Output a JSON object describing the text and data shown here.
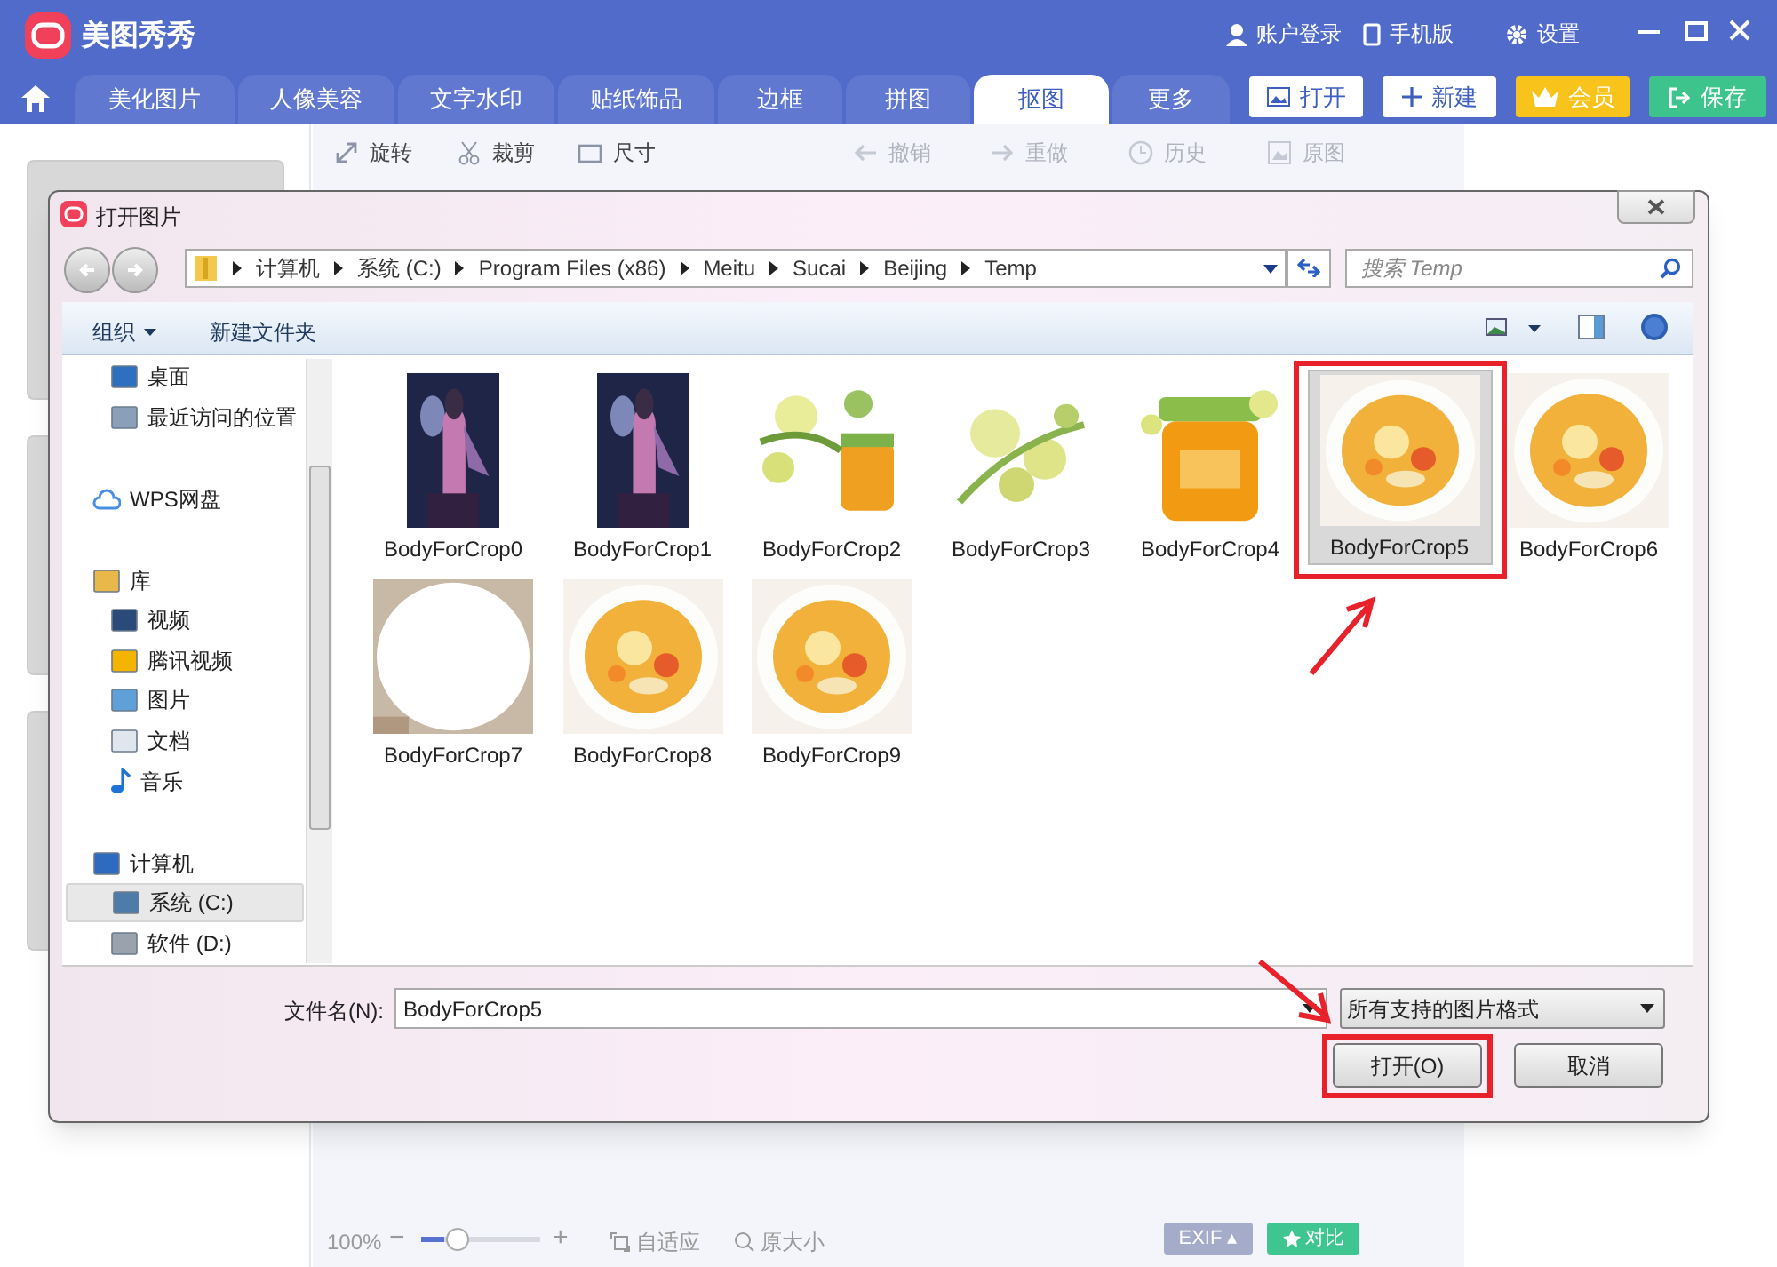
{
  "app": {
    "title": "美图秀秀",
    "top_links": [
      "账户登录",
      "手机版",
      "设置"
    ]
  },
  "tabs": [
    {
      "label": "美化图片",
      "selected": false
    },
    {
      "label": "人像美容",
      "selected": false
    },
    {
      "label": "文字水印",
      "selected": false
    },
    {
      "label": "贴纸饰品",
      "selected": false
    },
    {
      "label": "边框",
      "selected": false
    },
    {
      "label": "拼图",
      "selected": false
    },
    {
      "label": "抠图",
      "selected": true
    },
    {
      "label": "更多",
      "selected": false
    }
  ],
  "actions": [
    {
      "label": "打开",
      "kind": "open"
    },
    {
      "label": "新建",
      "kind": "new"
    },
    {
      "label": "会员",
      "kind": "vip"
    },
    {
      "label": "保存",
      "kind": "save"
    }
  ],
  "toolbar": [
    {
      "label": "旋转",
      "disabled": false
    },
    {
      "label": "裁剪",
      "disabled": false
    },
    {
      "label": "尺寸",
      "disabled": false
    },
    {
      "label": "撤销",
      "disabled": true
    },
    {
      "label": "重做",
      "disabled": true
    },
    {
      "label": "历史",
      "disabled": true
    },
    {
      "label": "原图",
      "disabled": true
    }
  ],
  "dialog": {
    "title": "打开图片",
    "path": [
      "计算机",
      "系统 (C:)",
      "Program Files (x86)",
      "Meitu",
      "Sucai",
      "Beijing",
      "Temp"
    ],
    "search": {
      "placeholder": "搜索 Temp"
    },
    "commands": [
      "组织",
      "新建文件夹"
    ],
    "nav": [
      {
        "children": [
          {
            "label": "桌面",
            "selected": false
          },
          {
            "label": "最近访问的位置",
            "selected": false
          }
        ]
      },
      {
        "label": "WPS网盘"
      },
      {
        "label": "库",
        "children": [
          {
            "label": "视频",
            "selected": false
          },
          {
            "label": "腾讯视频",
            "selected": false
          },
          {
            "label": "图片",
            "selected": false
          },
          {
            "label": "文档",
            "selected": false
          },
          {
            "label": "音乐",
            "selected": false
          }
        ]
      },
      {
        "label": "计算机",
        "children": [
          {
            "label": "系统 (C:)",
            "selected": true
          },
          {
            "label": "软件 (D:)",
            "selected": false
          }
        ]
      }
    ],
    "files": [
      {
        "name": "BodyForCrop0",
        "selected": false,
        "highlighted": false
      },
      {
        "name": "BodyForCrop1",
        "selected": false,
        "highlighted": false
      },
      {
        "name": "BodyForCrop2",
        "selected": false,
        "highlighted": false
      },
      {
        "name": "BodyForCrop3",
        "selected": false,
        "highlighted": false
      },
      {
        "name": "BodyForCrop4",
        "selected": false,
        "highlighted": false
      },
      {
        "name": "BodyForCrop5",
        "selected": true,
        "highlighted": true
      },
      {
        "name": "BodyForCrop6",
        "selected": false,
        "highlighted": false
      },
      {
        "name": "BodyForCrop7",
        "selected": false,
        "highlighted": false
      },
      {
        "name": "BodyForCrop8",
        "selected": false,
        "highlighted": false
      },
      {
        "name": "BodyForCrop9",
        "selected": false,
        "highlighted": false
      }
    ],
    "filename_label": "文件名(N):",
    "filename": "BodyForCrop5",
    "filter": "所有支持的图片格式",
    "buttons": [
      {
        "label": "打开(O)",
        "highlighted": true
      },
      {
        "label": "取消",
        "highlighted": false
      }
    ]
  },
  "bottom": {
    "zoom": "100%",
    "minus": "−",
    "plus": "+",
    "level": 0.2,
    "fit": "自适应",
    "actual": "原大小",
    "exif": "EXIF",
    "exif_caret": "▴",
    "compare": "对比"
  }
}
